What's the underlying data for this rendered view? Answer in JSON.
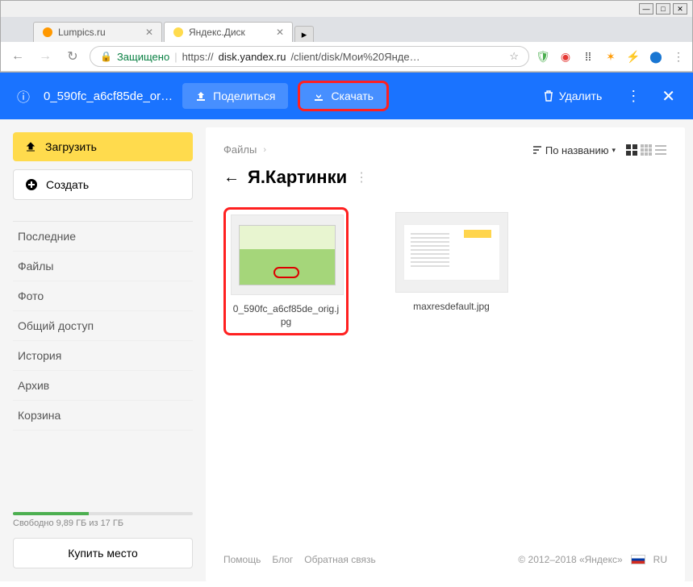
{
  "tabs": [
    {
      "title": "Lumpics.ru",
      "active": false
    },
    {
      "title": "Яндекс.Диск",
      "active": true
    }
  ],
  "address": {
    "secure_label": "Защищено",
    "url_prefix": "https://",
    "url_host": "disk.yandex.ru",
    "url_path": "/client/disk/Мои%20Янде…"
  },
  "actionbar": {
    "filename": "0_590fc_a6cf85de_or…",
    "share": "Поделиться",
    "download": "Скачать",
    "delete": "Удалить"
  },
  "sidebar": {
    "upload": "Загрузить",
    "create": "Создать",
    "items": [
      "Последние",
      "Файлы",
      "Фото",
      "Общий доступ",
      "История",
      "Архив",
      "Корзина"
    ],
    "storage_text": "Свободно 9,89 ГБ из 17 ГБ",
    "storage_pct": 42,
    "buy": "Купить место"
  },
  "main": {
    "breadcrumb_root": "Файлы",
    "sort_label": "По названию",
    "folder_title": "Я.Картинки",
    "files": [
      {
        "name": "0_590fc_a6cf85de_orig.jpg",
        "selected": true
      },
      {
        "name": "maxresdefault.jpg",
        "selected": false
      }
    ]
  },
  "footer": {
    "help": "Помощь",
    "blog": "Блог",
    "feedback": "Обратная связь",
    "copyright": "© 2012–2018 «Яндекс»",
    "lang": "RU"
  }
}
